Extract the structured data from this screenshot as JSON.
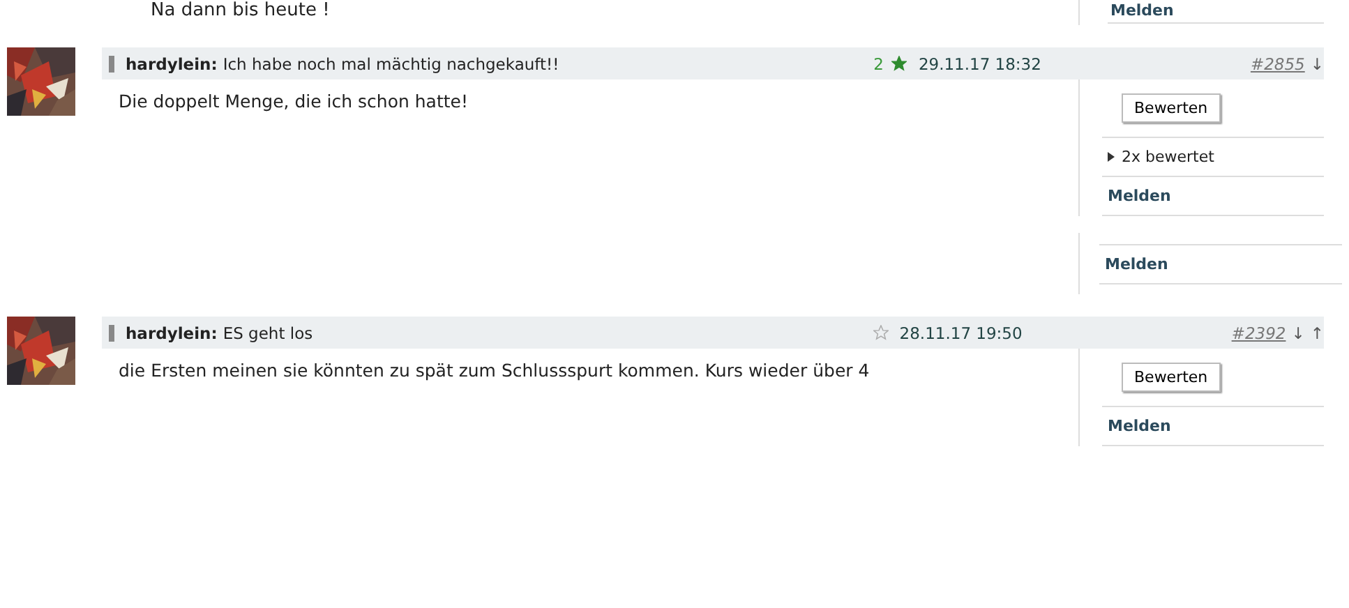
{
  "top_fragment": {
    "body": "Na dann bis heute !",
    "report": "Melden"
  },
  "posts": [
    {
      "author": "hardylein:",
      "title": "Ich habe noch mal mächtig nachgekauft!!",
      "rating_count": "2",
      "rated": true,
      "date": "29.11.17 18:32",
      "number": "#2855",
      "nav": [
        "↓"
      ],
      "body": "Die doppelt Menge, die ich schon hatte!",
      "rate_button": "Bewerten",
      "ratings_toggle": {
        "label": "2x bewertet",
        "expanded": false
      },
      "report": "Melden",
      "extra_report": "Melden"
    },
    {
      "author": "hardylein:",
      "title": "ES geht los",
      "rated": false,
      "date": "28.11.17 19:50",
      "number": "#2392",
      "nav": [
        "↓",
        "↑"
      ],
      "body": "die Ersten meinen sie könnten zu spät zum Schlussspurt kommen. Kurs wieder über 4",
      "rate_button": "Bewerten",
      "report": "Melden"
    }
  ]
}
